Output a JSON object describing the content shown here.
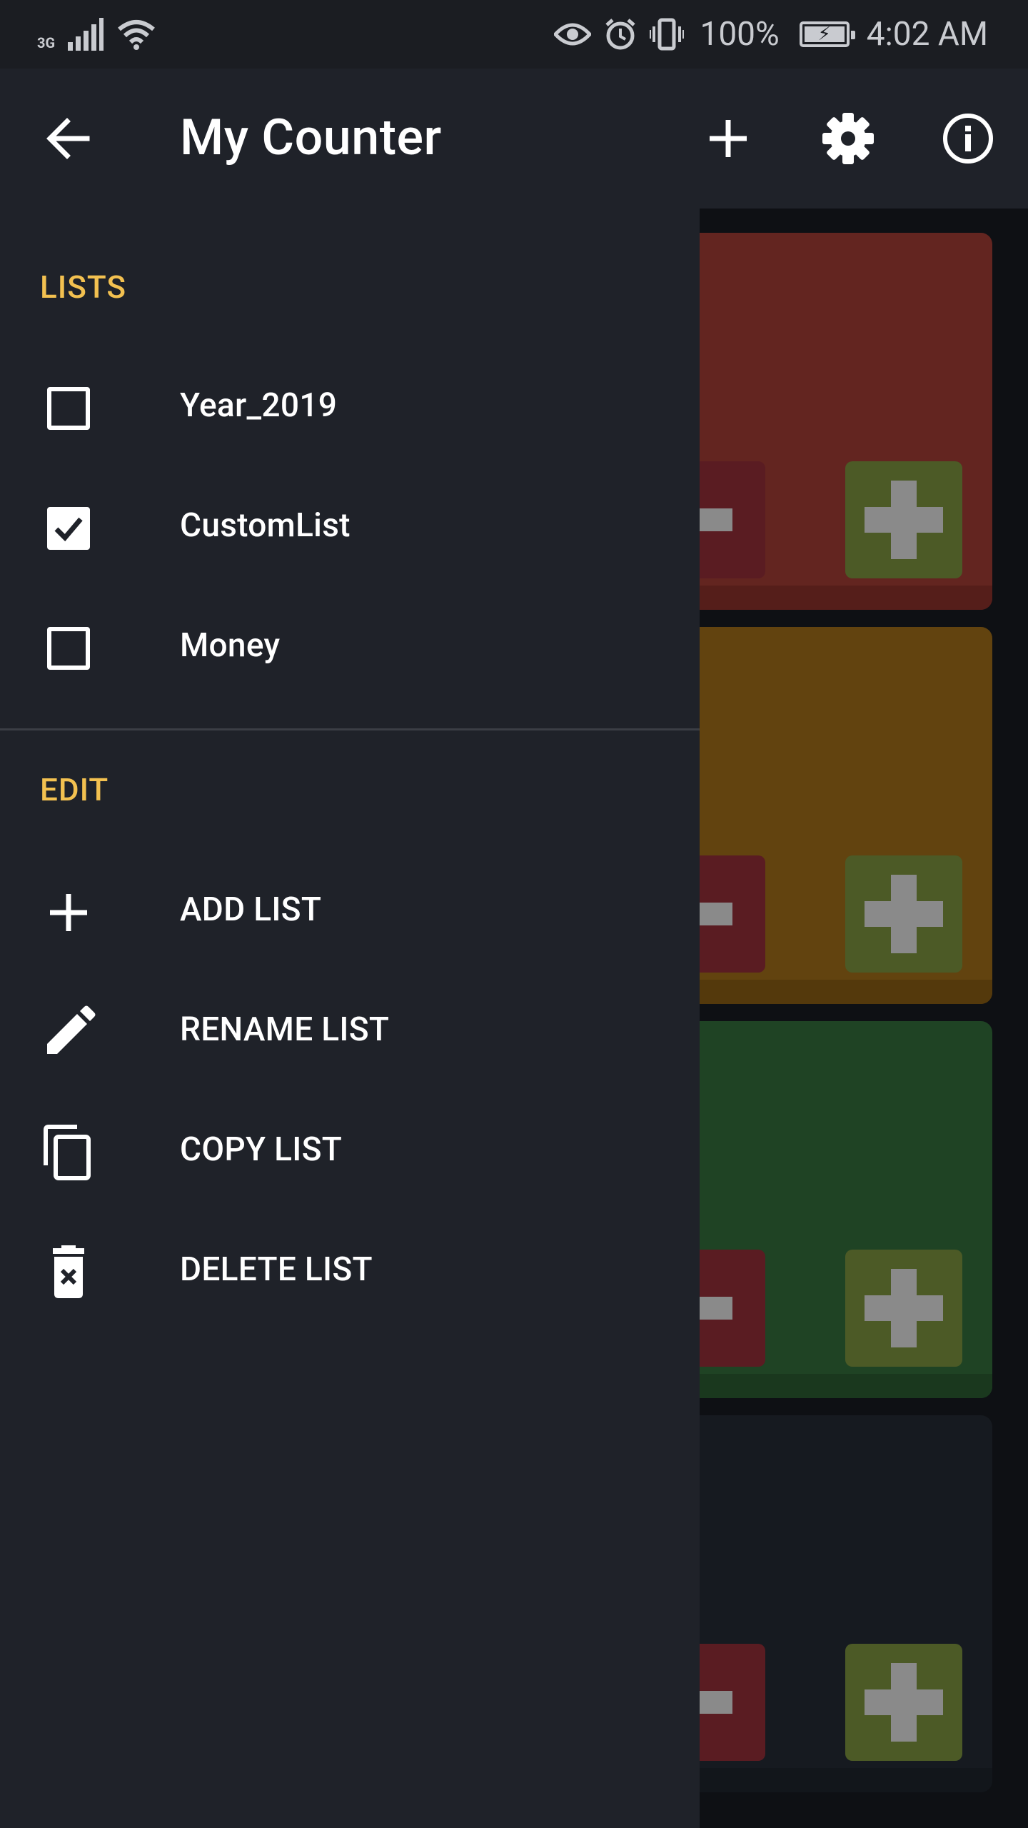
{
  "status_bar": {
    "network": "3G",
    "battery_percent": "100%",
    "time": "4:02 AM"
  },
  "app_bar": {
    "title": "My Counter",
    "icons": [
      "back-arrow-icon",
      "add-icon",
      "settings-icon",
      "info-icon"
    ]
  },
  "drawer": {
    "lists_header": "LISTS",
    "lists": [
      {
        "label": "Year_2019",
        "checked": false
      },
      {
        "label": "CustomList",
        "checked": true
      },
      {
        "label": "Money",
        "checked": false
      }
    ],
    "edit_header": "EDIT",
    "actions": [
      {
        "label": "ADD LIST",
        "icon": "plus-icon"
      },
      {
        "label": "RENAME LIST",
        "icon": "pencil-icon"
      },
      {
        "label": "COPY LIST",
        "icon": "copy-icon"
      },
      {
        "label": "DELETE LIST",
        "icon": "delete-icon"
      }
    ]
  },
  "counters": [
    {
      "color": "#632520"
    },
    {
      "color": "#62430f"
    },
    {
      "color": "#1f4324"
    },
    {
      "color": "#161a20"
    }
  ],
  "colors": {
    "accent": "#f3c150",
    "drawer_bg": "#1f2229",
    "app_bar_bg": "#1f2229",
    "status_bar_bg": "#1b1d22"
  }
}
